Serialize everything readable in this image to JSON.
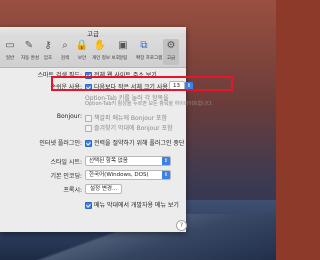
{
  "window": {
    "title": "고급"
  },
  "toolbar": {
    "items": [
      {
        "label": "일반",
        "icon": "switch-icon"
      },
      {
        "label": "자동 완성",
        "icon": "pencil-icon"
      },
      {
        "label": "암호",
        "icon": "key-icon"
      },
      {
        "label": "검색",
        "icon": "magnifier-icon"
      },
      {
        "label": "보안",
        "icon": "lock-icon"
      },
      {
        "label": "개인 정보 보호",
        "icon": "hand-icon"
      },
      {
        "label": "알림",
        "icon": "bell-icon"
      },
      {
        "label": "확장 프로그램",
        "icon": "puzzle-icon"
      },
      {
        "label": "고급",
        "icon": "gear-icon"
      }
    ]
  },
  "settings": {
    "smart_search": {
      "label": "스마트 검색 필드:",
      "option": "전체 웹 사이트 주소 보기",
      "checked": true
    },
    "accessibility": {
      "label": "손쉬운 사용:",
      "option": "다음보다 작은 서체 크기 사용 안 함",
      "font_size": "13",
      "checked": true,
      "note_line1": "Option-Tab 키를 눌러 각 항목을",
      "note_line2": "Option-Tab키 활성을 누르면 모든 항목을 하이라이트합니다."
    },
    "bonjour": {
      "label": "Bonjour:",
      "option1": "책갈피 메뉴에 Bonjour 포함",
      "option2": "즐겨찾기 막대에 Bonjour 포함"
    },
    "plugins": {
      "label": "인터넷 플러그인:",
      "option": "전력을 절약하기 위해 플러그인 중단",
      "checked": true
    },
    "stylesheet": {
      "label": "스타일 시트:",
      "value": "선택된 항목 없음"
    },
    "encoding": {
      "label": "기본 인코딩:",
      "value": "한국어(Windows, DOS)"
    },
    "proxies": {
      "label": "프록시:",
      "button": "설정 변경..."
    },
    "develop": {
      "option": "메뉴 막대에서 개발자용 메뉴 보기",
      "checked": true
    }
  },
  "help": "?"
}
